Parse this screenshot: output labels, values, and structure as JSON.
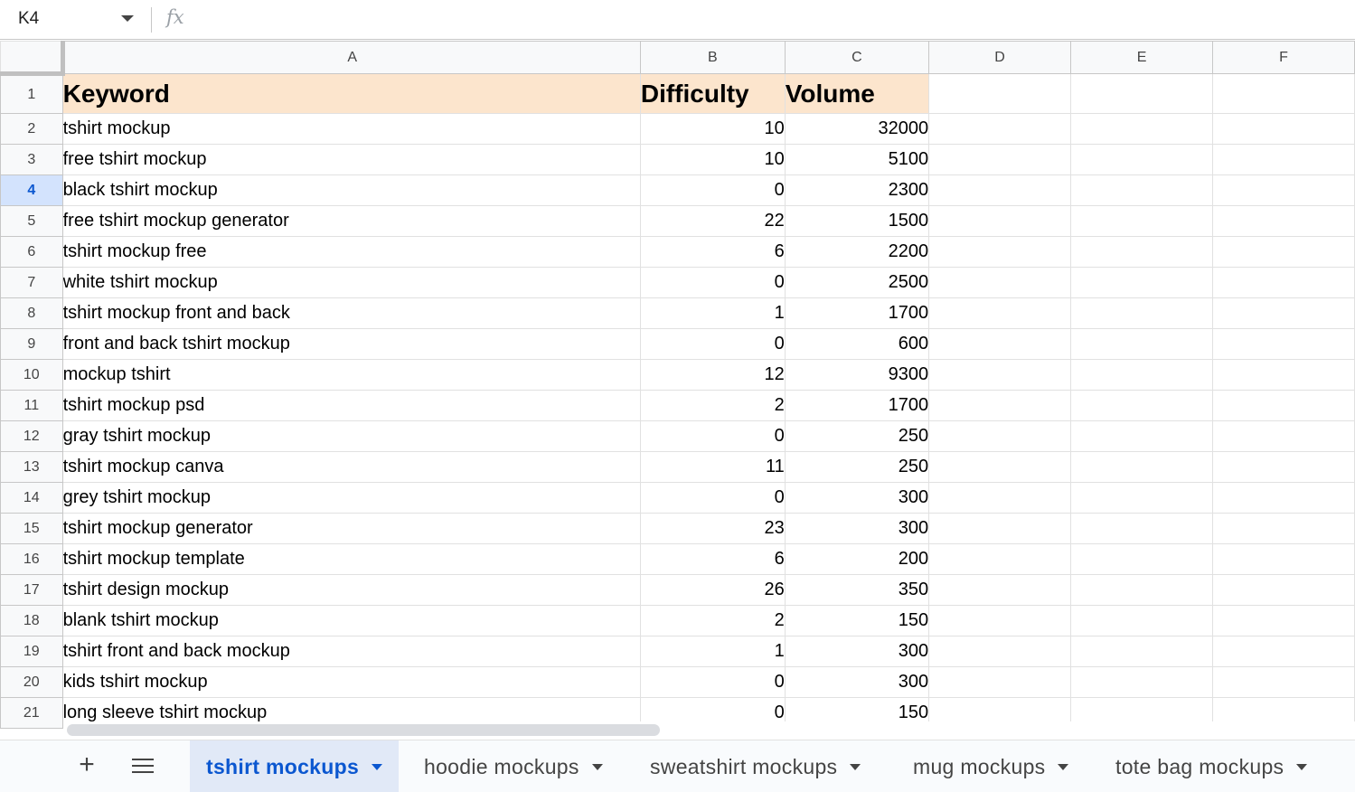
{
  "formula_bar": {
    "name_box": "K4",
    "fx_label": "fx",
    "formula_value": ""
  },
  "columns": [
    "A",
    "B",
    "C",
    "D",
    "E",
    "F"
  ],
  "active_row": 4,
  "header_row": {
    "row_number": "1",
    "cells": [
      "Keyword",
      "Difficulty",
      "Volume"
    ]
  },
  "rows": [
    {
      "n": "2",
      "keyword": "tshirt mockup",
      "difficulty": "10",
      "volume": "32000"
    },
    {
      "n": "3",
      "keyword": "free tshirt mockup",
      "difficulty": "10",
      "volume": "5100"
    },
    {
      "n": "4",
      "keyword": "black tshirt mockup",
      "difficulty": "0",
      "volume": "2300"
    },
    {
      "n": "5",
      "keyword": "free tshirt mockup generator",
      "difficulty": "22",
      "volume": "1500"
    },
    {
      "n": "6",
      "keyword": "tshirt mockup free",
      "difficulty": "6",
      "volume": "2200"
    },
    {
      "n": "7",
      "keyword": "white tshirt mockup",
      "difficulty": "0",
      "volume": "2500"
    },
    {
      "n": "8",
      "keyword": "tshirt mockup front and back",
      "difficulty": "1",
      "volume": "1700"
    },
    {
      "n": "9",
      "keyword": "front and back tshirt mockup",
      "difficulty": "0",
      "volume": "600"
    },
    {
      "n": "10",
      "keyword": "mockup tshirt",
      "difficulty": "12",
      "volume": "9300"
    },
    {
      "n": "11",
      "keyword": "tshirt mockup psd",
      "difficulty": "2",
      "volume": "1700"
    },
    {
      "n": "12",
      "keyword": "gray tshirt mockup",
      "difficulty": "0",
      "volume": "250"
    },
    {
      "n": "13",
      "keyword": "tshirt mockup canva",
      "difficulty": "11",
      "volume": "250"
    },
    {
      "n": "14",
      "keyword": "grey tshirt mockup",
      "difficulty": "0",
      "volume": "300"
    },
    {
      "n": "15",
      "keyword": "tshirt mockup generator",
      "difficulty": "23",
      "volume": "300"
    },
    {
      "n": "16",
      "keyword": "tshirt mockup template",
      "difficulty": "6",
      "volume": "200"
    },
    {
      "n": "17",
      "keyword": "tshirt design mockup",
      "difficulty": "26",
      "volume": "350"
    },
    {
      "n": "18",
      "keyword": "blank tshirt mockup",
      "difficulty": "2",
      "volume": "150"
    },
    {
      "n": "19",
      "keyword": "tshirt front and back mockup",
      "difficulty": "1",
      "volume": "300"
    },
    {
      "n": "20",
      "keyword": "kids tshirt mockup",
      "difficulty": "0",
      "volume": "300"
    },
    {
      "n": "21",
      "keyword": "long sleeve tshirt mockup",
      "difficulty": "0",
      "volume": "150"
    }
  ],
  "sheet_tabs": [
    {
      "label": "tshirt mockups",
      "active": true
    },
    {
      "label": "hoodie mockups",
      "active": false
    },
    {
      "label": "sweatshirt mockups",
      "active": false
    },
    {
      "label": "mug mockups",
      "active": false
    },
    {
      "label": "tote bag mockups",
      "active": false
    }
  ],
  "colors": {
    "header_fill": "#fce5cd",
    "active_row_fill": "#d3e3fd",
    "active_accent": "#0b57d0"
  }
}
